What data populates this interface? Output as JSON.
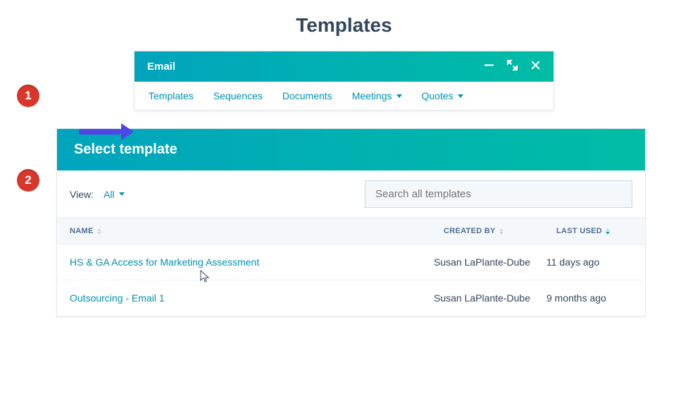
{
  "page_title": "Templates",
  "steps": {
    "one": "1",
    "two": "2"
  },
  "email_window": {
    "title": "Email",
    "tabs": {
      "templates": "Templates",
      "sequences": "Sequences",
      "documents": "Documents",
      "meetings": "Meetings",
      "quotes": "Quotes"
    }
  },
  "select_panel": {
    "title": "Select template",
    "view_label": "View:",
    "view_value": "All",
    "search_placeholder": "Search all templates",
    "columns": {
      "name": "NAME",
      "created_by": "CREATED BY",
      "last_used": "LAST USED"
    },
    "rows": [
      {
        "name": "HS & GA Access for Marketing Assessment",
        "created_by": "Susan LaPlante-Dube",
        "last_used": "11 days ago"
      },
      {
        "name": "Outsourcing - Email 1",
        "created_by": "Susan LaPlante-Dube",
        "last_used": "9 months ago"
      }
    ]
  }
}
